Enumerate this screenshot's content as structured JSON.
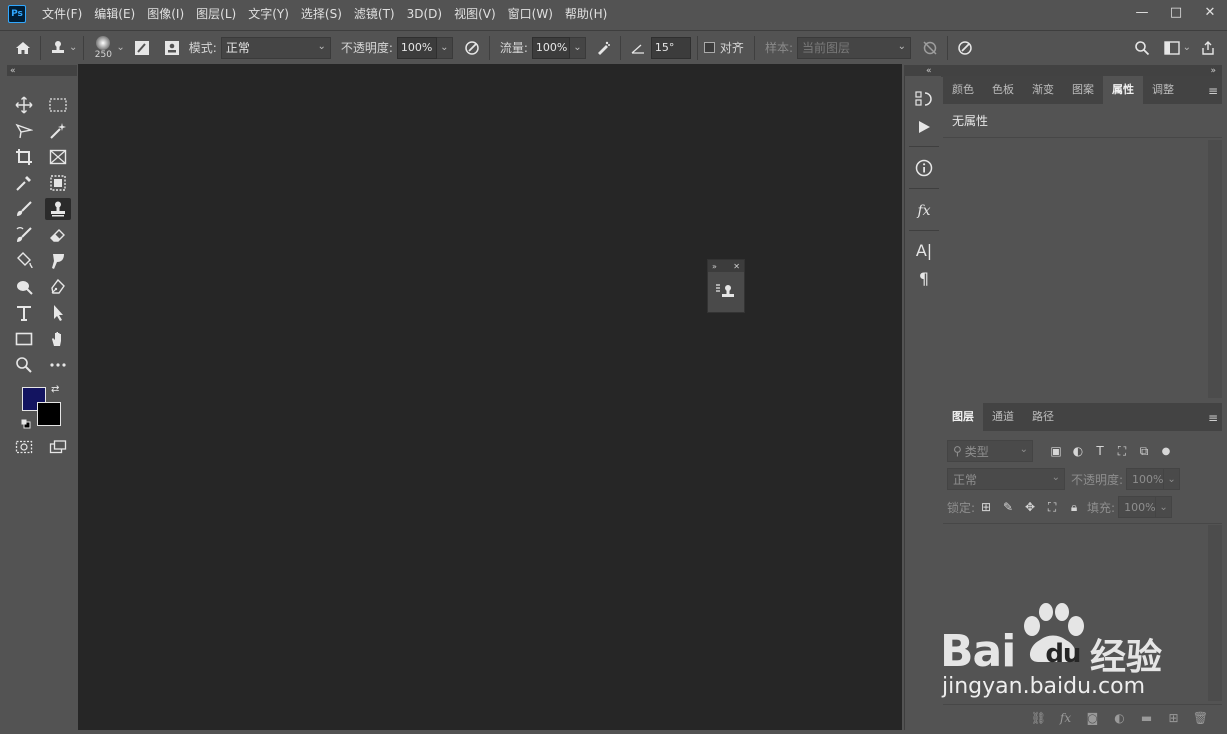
{
  "app": {
    "logo": "Ps"
  },
  "menu": [
    "文件(F)",
    "编辑(E)",
    "图像(I)",
    "图层(L)",
    "文字(Y)",
    "选择(S)",
    "滤镜(T)",
    "3D(D)",
    "视图(V)",
    "窗口(W)",
    "帮助(H)"
  ],
  "window_controls": {
    "minimize": "—",
    "maximize": "□",
    "close": "✕"
  },
  "options": {
    "brush_size": "250",
    "mode_label": "模式:",
    "mode_value": "正常",
    "opacity_label": "不透明度:",
    "opacity_value": "100%",
    "flow_label": "流量:",
    "flow_value": "100%",
    "angle_value": "15°",
    "align_label": "对齐",
    "sample_label": "样本:",
    "sample_value": "当前图层"
  },
  "tool_colors": {
    "foreground": "#131460",
    "background": "#000000"
  },
  "properties_panel": {
    "tabs": [
      "颜色",
      "色板",
      "渐变",
      "图案",
      "属性",
      "调整"
    ],
    "active_tab": "属性",
    "no_props": "无属性"
  },
  "layers_panel": {
    "tabs": [
      "图层",
      "通道",
      "路径"
    ],
    "active_tab": "图层",
    "filter_kind": "类型",
    "blend_mode": "正常",
    "opacity_label": "不透明度:",
    "opacity_value": "100%",
    "lock_label": "锁定:",
    "fill_label": "填充:",
    "fill_value": "100%"
  },
  "watermark": {
    "brand_left": "Bai",
    "brand_right": "du",
    "brand_cn": "经验",
    "url": "jingyan.baidu.com"
  }
}
